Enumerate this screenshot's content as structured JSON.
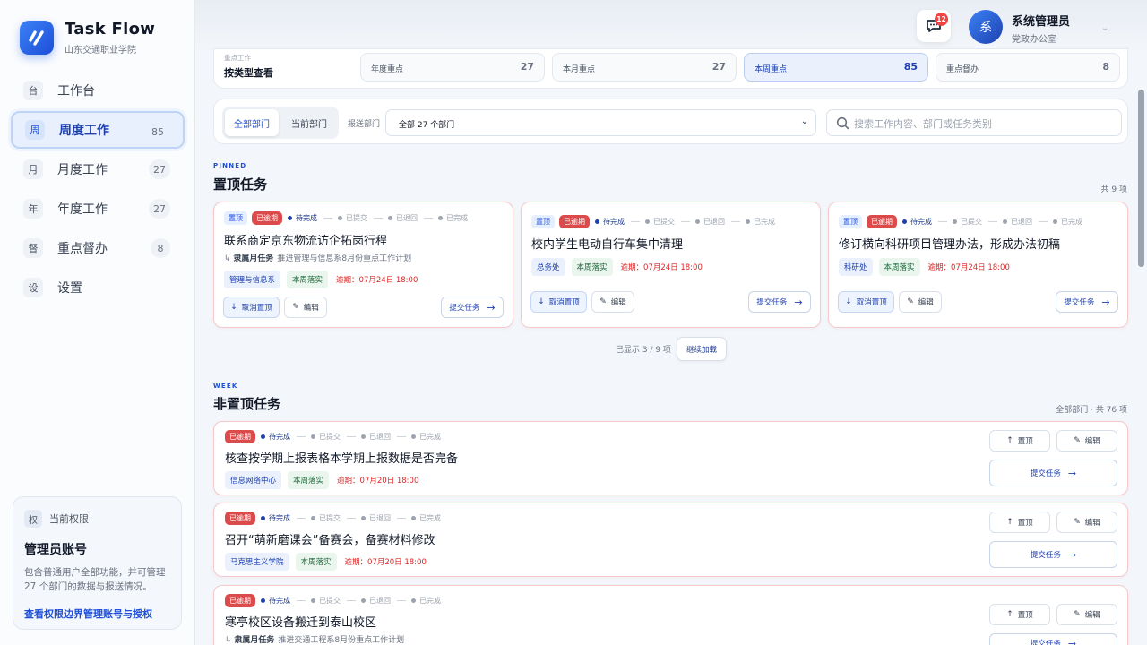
{
  "brand": {
    "title": "Task Flow",
    "subtitle": "山东交通职业学院"
  },
  "nav": [
    {
      "icon": "台",
      "label": "工作台",
      "count": ""
    },
    {
      "icon": "周",
      "label": "周度工作",
      "count": "85"
    },
    {
      "icon": "月",
      "label": "月度工作",
      "count": "27"
    },
    {
      "icon": "年",
      "label": "年度工作",
      "count": "27"
    },
    {
      "icon": "督",
      "label": "重点督办",
      "count": "8"
    },
    {
      "icon": "设",
      "label": "设置",
      "count": ""
    }
  ],
  "permission": {
    "icon": "权",
    "heading": "当前权限",
    "title": "管理员账号",
    "desc": "包含普通用户全部功能，并可管理 27 个部门的数据与报送情况。",
    "link": "查看权限边界管理账号与授权"
  },
  "header": {
    "notify_count": "12",
    "avatar": "系",
    "user_name": "系统管理员",
    "user_role": "党政办公室"
  },
  "typebar": {
    "kicker": "重点工作",
    "label": "按类型查看",
    "cards": [
      {
        "name": "年度重点",
        "value": "27"
      },
      {
        "name": "本月重点",
        "value": "27"
      },
      {
        "name": "本周重点",
        "value": "85"
      },
      {
        "name": "重点督办",
        "value": "8"
      }
    ]
  },
  "filter": {
    "seg_all": "全部部门",
    "seg_current": "当前部门",
    "dept_label": "报送部门",
    "dept_value": "全部 27 个部门",
    "search_placeholder": "搜索工作内容、部门或任务类别"
  },
  "pinned": {
    "kicker": "PINNED",
    "title": "置顶任务",
    "count": "共 9 项",
    "shown": "已显示 3 / 9 项",
    "load_more": "继续加载"
  },
  "week": {
    "kicker": "WEEK",
    "title": "非置顶任务",
    "count": "全部部门 · 共 76 项"
  },
  "labels": {
    "pin": "置顶",
    "overdue": "已逾期",
    "s1": "待完成",
    "s2": "已提交",
    "s3": "已退回",
    "s4": "已完成",
    "unpin": "取消置顶",
    "edit": "编辑",
    "submit": "提交任务",
    "pin_btn": "置顶",
    "parent_prefix": "隶属月任务"
  },
  "pinned_tasks": [
    {
      "title": "联系商定京东物流访企拓岗行程",
      "parent": "推进管理与信息系8月份重点工作计划",
      "dept": "管理与信息系",
      "week": "本周落实",
      "due": "逾期：07月24日 18:00"
    },
    {
      "title": "校内学生电动自行车集中清理",
      "parent": "",
      "dept": "总务处",
      "week": "本周落实",
      "due": "逾期：07月24日 18:00"
    },
    {
      "title": "修订横向科研项目管理办法，形成办法初稿",
      "parent": "",
      "dept": "科研处",
      "week": "本周落实",
      "due": "逾期：07月24日 18:00"
    }
  ],
  "tasks": [
    {
      "title": "核查按学期上报表格本学期上报数据是否完备",
      "parent": "",
      "dept": "信息网络中心",
      "week": "本周落实",
      "due": "逾期：07月20日 18:00"
    },
    {
      "title": "召开“萌新磨课会”备赛会，备赛材料修改",
      "parent": "",
      "dept": "马克思主义学院",
      "week": "本周落实",
      "due": "逾期：07月20日 18:00"
    },
    {
      "title": "寒亭校区设备搬迁到泰山校区",
      "parent": "推进交通工程系8月份重点工作计划",
      "dept": "",
      "week": "",
      "due": ""
    }
  ]
}
